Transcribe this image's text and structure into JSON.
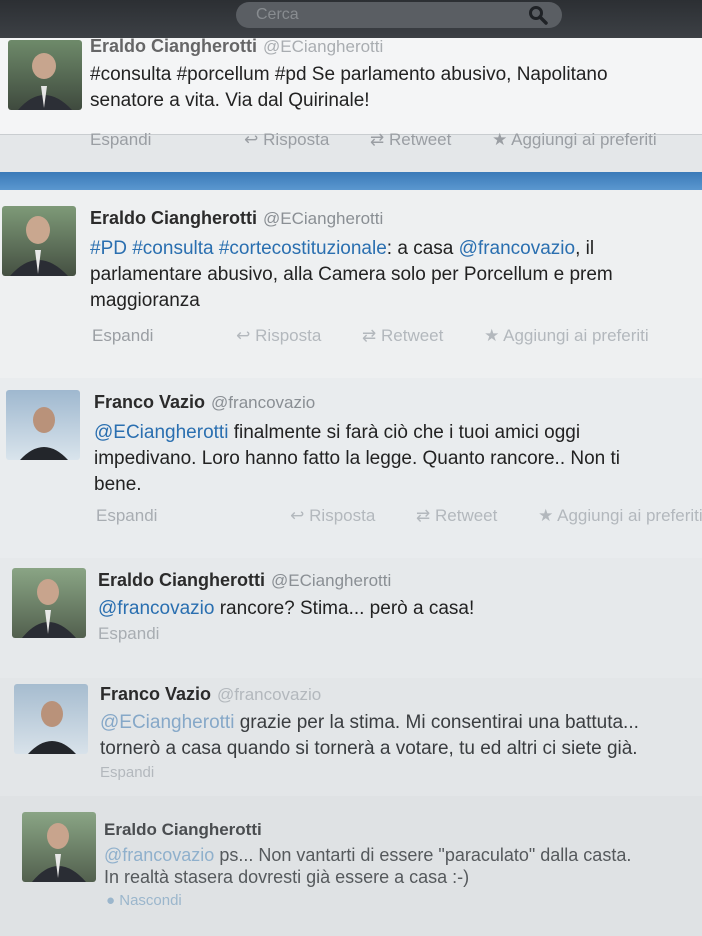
{
  "search": {
    "placeholder": "Cerca"
  },
  "actions": {
    "expand": "Espandi",
    "reply": "Risposta",
    "retweet": "Retweet",
    "favorite": "Aggiungi ai preferiti",
    "hide": "Nascondi"
  },
  "tweets": [
    {
      "name": "Eraldo Ciangherotti",
      "handle": "@ECiangherotti",
      "line1": "#consulta #porcellum #pd Se parlamento abusivo, Napolitano",
      "line2": "senatore a vita. Via dal Quirinale!"
    },
    {
      "name": "Eraldo Ciangherotti",
      "handle": "@ECiangherotti",
      "tags": "#PD #consulta #cortecostituzionale",
      "seg1": ": a casa ",
      "mention": "@francovazio",
      "seg2": ", il",
      "line2": "parlamentare abusivo, alla Camera solo per Porcellum e prem",
      "line3": "maggioranza"
    },
    {
      "name": "Franco Vazio",
      "handle": "@francovazio",
      "mention": "@ECiangherotti",
      "seg1": " finalmente si farà ciò che i tuoi amici oggi",
      "line2": "impedivano. Loro hanno fatto la legge. Quanto rancore.. Non ti",
      "line3": "bene."
    },
    {
      "name": "Eraldo Ciangherotti",
      "handle": "@ECiangherotti",
      "mention": "@francovazio",
      "seg1": " rancore? Stima... però a casa!"
    },
    {
      "name": "Franco Vazio",
      "handle": "@francovazio",
      "mention": "@ECiangherotti",
      "seg1": " grazie per la stima. Mi consentirai una battuta...",
      "line2": "tornerò a casa quando si tornerà a votare, tu ed altri ci siete già."
    },
    {
      "name": "Eraldo Ciangherotti",
      "handle": "@ECiangherotti",
      "mention": "@francovazio",
      "seg1": " ps... Non vantarti di essere \"paraculato\" dalla casta.",
      "line2": "In realtà stasera dovresti già essere a casa :-)"
    }
  ],
  "colors": {
    "link": "#2a6fb0",
    "bar": "#3a7ab8",
    "text": "#222222",
    "muted": "#9a9ea3"
  }
}
